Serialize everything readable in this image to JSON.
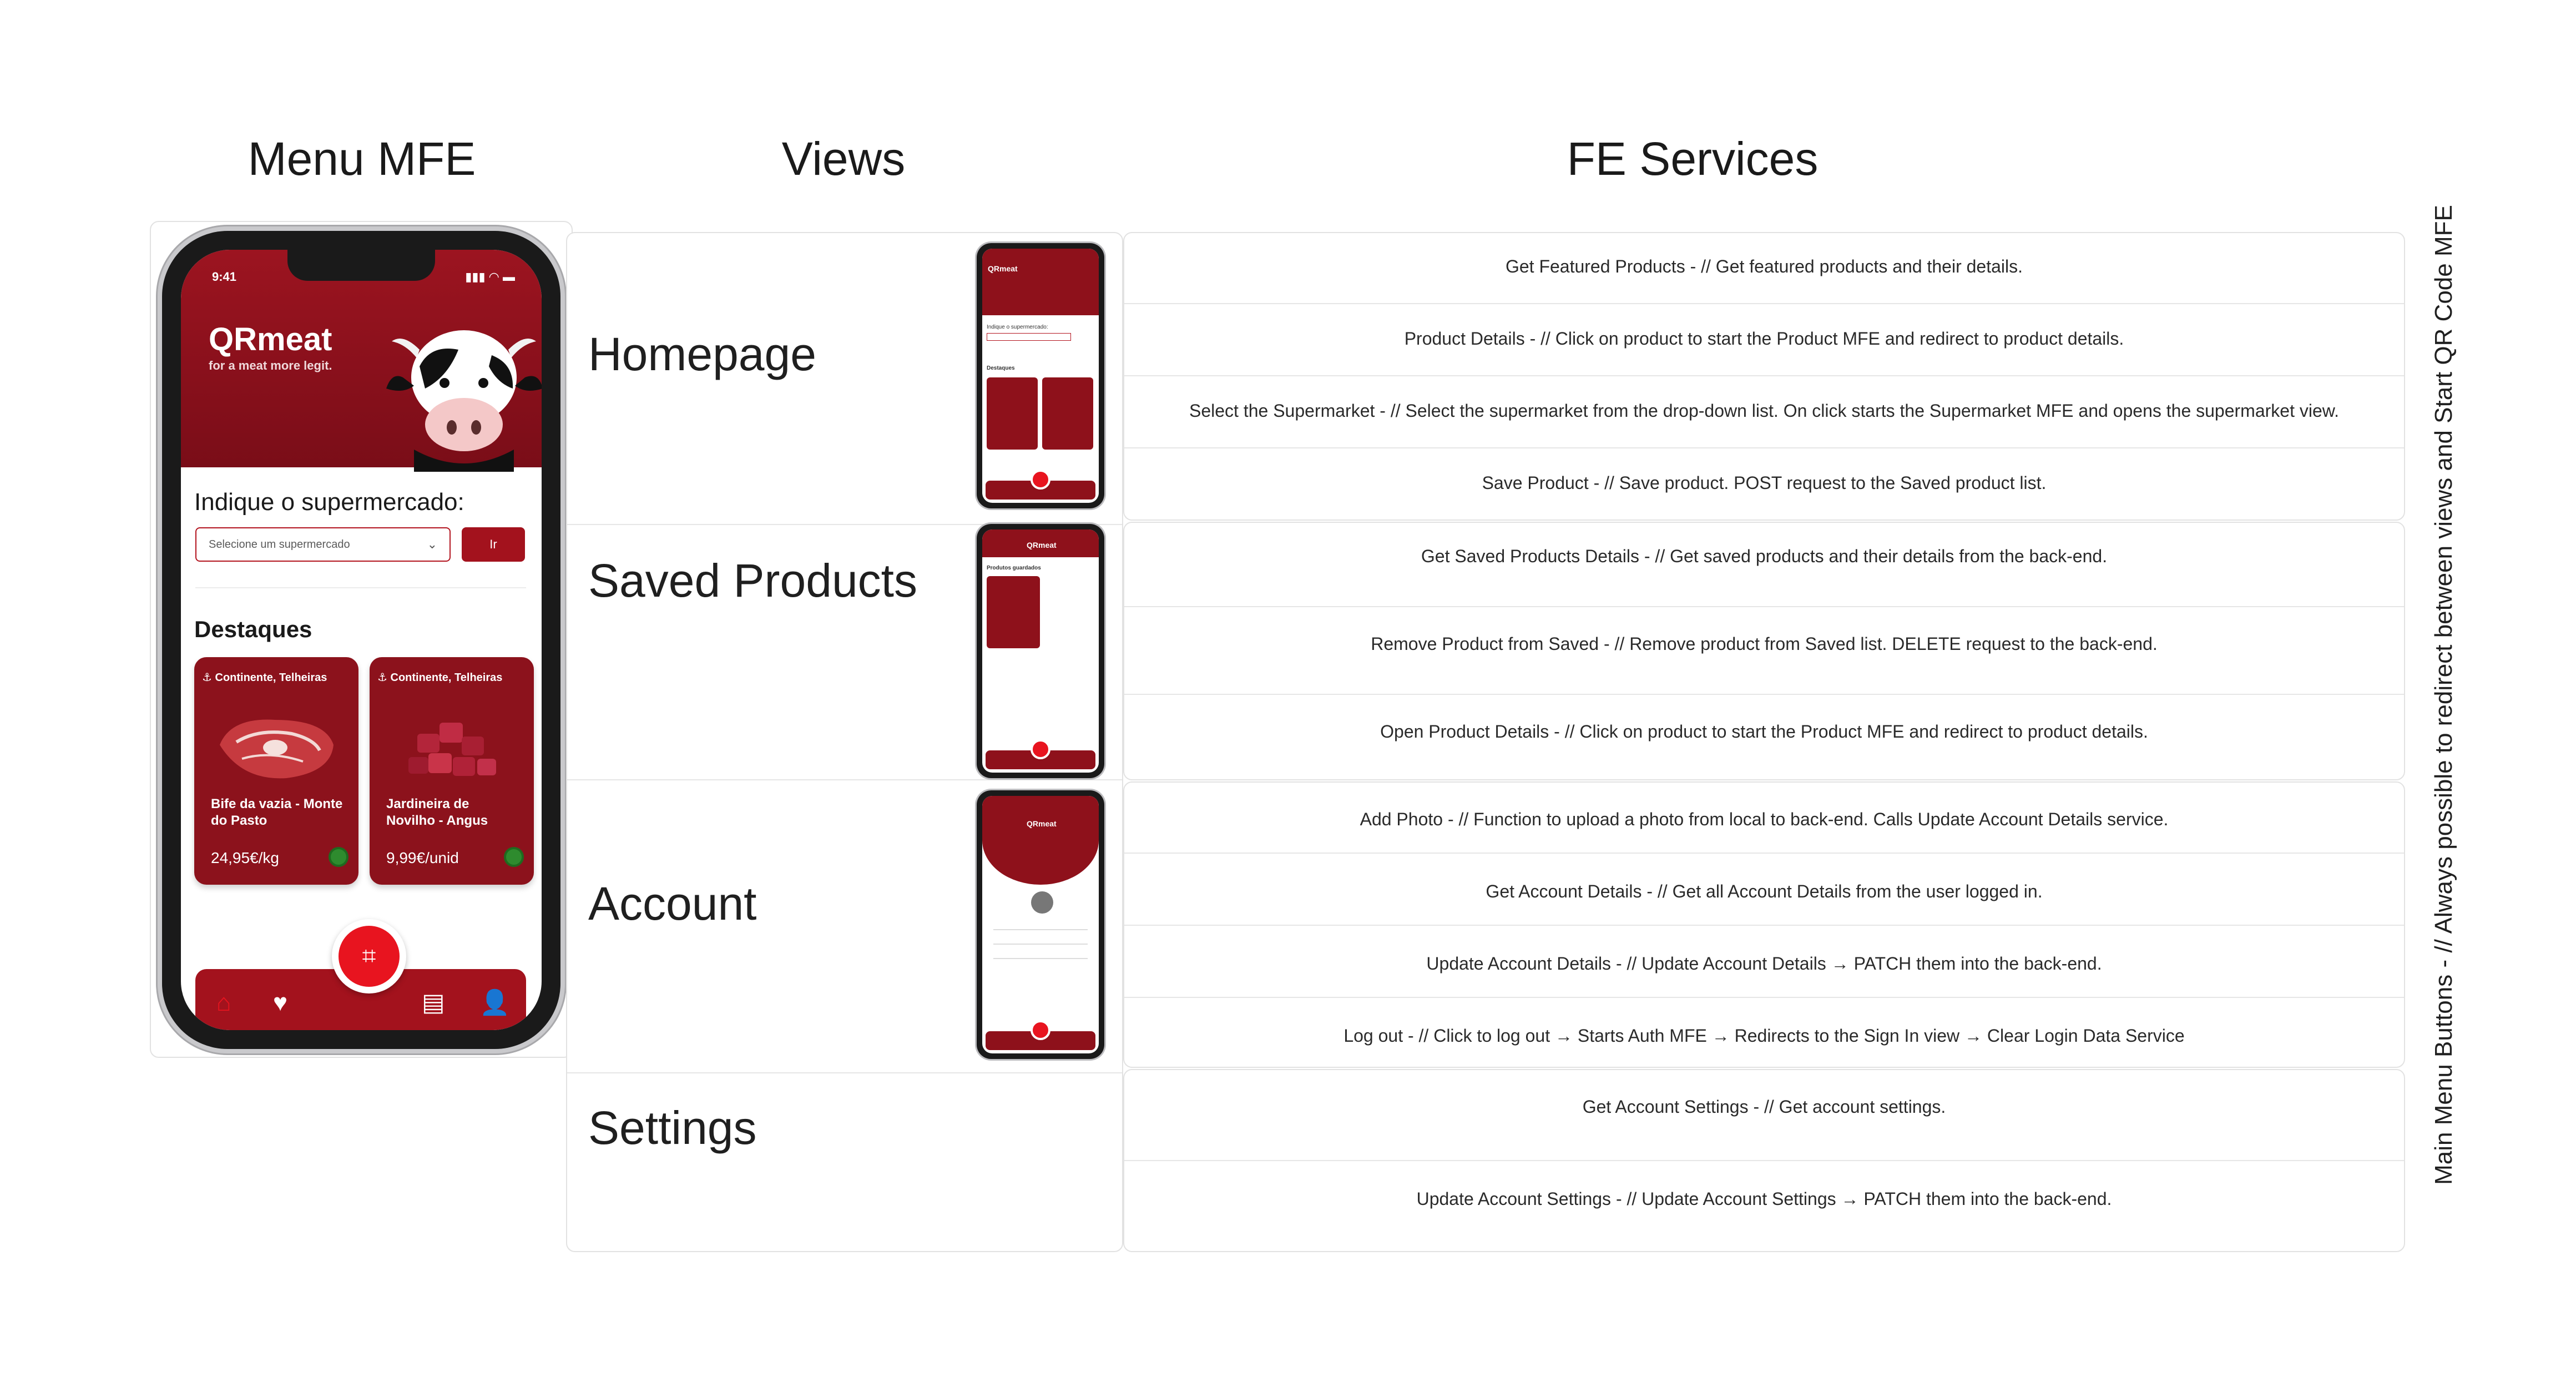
{
  "headers": {
    "menu": "Menu MFE",
    "views": "Views",
    "services": "FE Services"
  },
  "side_note": "Main Menu Buttons - // Always possible to redirect between views and Start QR Code MFE",
  "phone": {
    "time": "9:41",
    "brand": "QRmeat",
    "tagline": "for a meat more legit.",
    "supermarket_label": "Indique o supermercado:",
    "select_placeholder": "Selecione um supermercado",
    "go_label": "Ir",
    "featured_title": "Destaques",
    "products": [
      {
        "location": "Continente, Telheiras",
        "name": "Bife da vazia - Monte do Pasto",
        "price": "24,95€/kg"
      },
      {
        "location": "Continente, Telheiras",
        "name": "Jardineira de Novilho - Angus",
        "price": "9,99€/unid"
      }
    ],
    "nav_icons": [
      "home-icon",
      "heart-icon",
      "receipt-icon",
      "user-icon"
    ],
    "brand_color": "#a3121d"
  },
  "mini_screens": {
    "home_title": "QRmeat",
    "home_label": "Indique o supermercado:",
    "home_featured": "Destaques",
    "saved_title": "QRmeat",
    "saved_header": "Produtos guardados",
    "account_title": "QRmeat"
  },
  "views": [
    "Homepage",
    "Saved Products",
    "Account",
    "Settings"
  ],
  "services": {
    "homepage": [
      "Get Featured Products - // Get featured products and their details.",
      "Product Details - // Click on product to start the Product MFE and redirect to product details.",
      "Select the Supermarket - // Select the supermarket from the drop-down list. On click starts the Supermarket MFE and opens the supermarket view.",
      "Save Product - // Save product. POST request to the Saved product list."
    ],
    "saved": [
      "Get Saved Products Details - // Get saved products and their details from the back-end.",
      "Remove Product from Saved - // Remove product from Saved list. DELETE request to the back-end.",
      "Open Product Details - // Click on product to start the Product MFE and redirect to product details."
    ],
    "account": [
      "Add Photo - // Function to upload a photo from local to back-end. Calls Update Account Details service.",
      "Get Account Details - // Get all Account Details from the user logged in.",
      "Update Account Details - // Update Account Details → PATCH them into the back-end.",
      "Log out - // Click to log out → Starts Auth MFE → Redirects to the Sign In view → Clear Login Data Service"
    ],
    "settings": [
      "Get Account Settings - // Get account settings.",
      "Update Account Settings - // Update Account Settings → PATCH them into the back-end."
    ]
  }
}
